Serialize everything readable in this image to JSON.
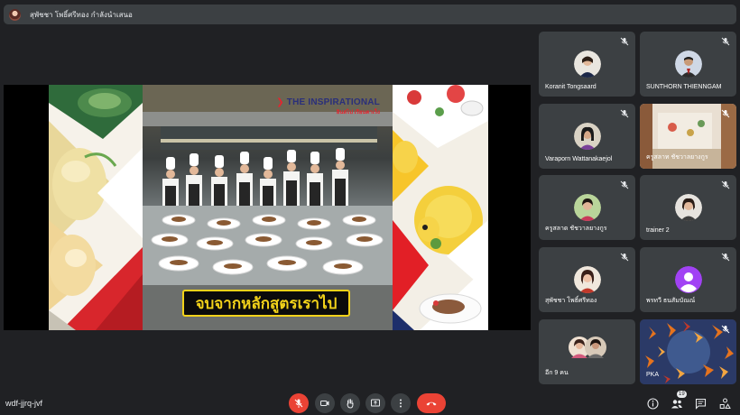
{
  "presenter_bar": {
    "text": "สุพัชชา โพธิ์ศรีทอง กำลังนำเสนอ"
  },
  "slide": {
    "brand_main": "THE INSPIRATIONAL",
    "brand_sub": "อินสไป เรียนดาเร็ง",
    "caption": "จบจากหลักสูตรเราไป"
  },
  "participants": [
    {
      "name": "Koranit Tongsaard"
    },
    {
      "name": "SUNTHORN THIENNGAM"
    },
    {
      "name": "Varaporn Wattanakaejol"
    },
    {
      "name": "ครูสลาท ชัชวาลยางกูร"
    },
    {
      "name": "ครูสลาด ชัชวาลยางกูร"
    },
    {
      "name": "trainer 2"
    },
    {
      "name": "สุพัชชา โพธิ์ศรีทอง"
    },
    {
      "name": "พรทวี ธนสัมบัณณ์"
    },
    {
      "name": "อีก 9 คน"
    },
    {
      "name": "PKA"
    }
  ],
  "bottom_bar": {
    "meeting_code": "wdf-jjrq-jvf",
    "people_count": "19"
  },
  "colors": {
    "background": "#202124",
    "tile": "#3c4043",
    "danger": "#ea4335",
    "presenter_avatar": "#f2c7b0"
  },
  "icons": {
    "mic": "mic-off-icon",
    "camera": "camera-icon",
    "hand": "raise-hand-icon",
    "present": "present-icon",
    "more": "more-vert-icon",
    "end": "end-call-icon",
    "info": "info-icon",
    "people": "people-icon",
    "chat": "chat-icon",
    "activities": "activities-icon"
  }
}
